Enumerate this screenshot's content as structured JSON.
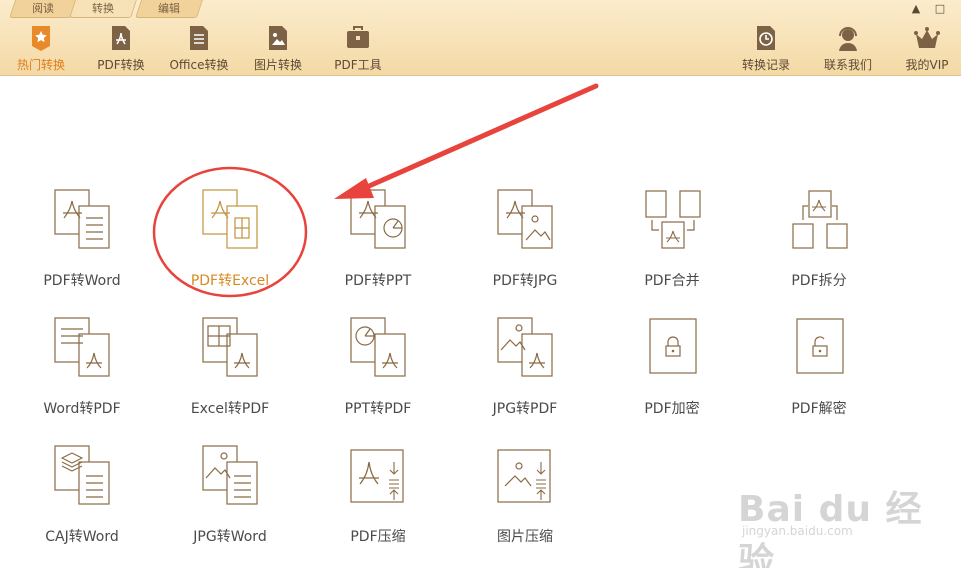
{
  "header": {
    "tabs": [
      {
        "label": "阅读"
      },
      {
        "label": "转换"
      },
      {
        "label": "编辑"
      }
    ],
    "toolbar_left": [
      {
        "label": "热门转换",
        "icon": "star-icon",
        "active": true
      },
      {
        "label": "PDF转换",
        "icon": "pdf-doc-icon"
      },
      {
        "label": "Office转换",
        "icon": "office-doc-icon"
      },
      {
        "label": "图片转换",
        "icon": "image-doc-icon"
      },
      {
        "label": "PDF工具",
        "icon": "toolbox-icon"
      }
    ],
    "toolbar_right": [
      {
        "label": "转换记录",
        "icon": "clock-icon"
      },
      {
        "label": "联系我们",
        "icon": "headset-icon"
      },
      {
        "label": "我的VIP",
        "icon": "crown-icon"
      }
    ],
    "window_controls": [
      "▲",
      "□"
    ]
  },
  "grid": [
    {
      "label": "PDF转Word",
      "icon": "pdf-to-word-icon"
    },
    {
      "label": "PDF转Excel",
      "icon": "pdf-to-excel-icon",
      "selected": true
    },
    {
      "label": "PDF转PPT",
      "icon": "pdf-to-ppt-icon"
    },
    {
      "label": "PDF转JPG",
      "icon": "pdf-to-jpg-icon"
    },
    {
      "label": "PDF合并",
      "icon": "pdf-merge-icon"
    },
    {
      "label": "PDF拆分",
      "icon": "pdf-split-icon"
    },
    {
      "label": "Word转PDF",
      "icon": "word-to-pdf-icon"
    },
    {
      "label": "Excel转PDF",
      "icon": "excel-to-pdf-icon"
    },
    {
      "label": "PPT转PDF",
      "icon": "ppt-to-pdf-icon"
    },
    {
      "label": "JPG转PDF",
      "icon": "jpg-to-pdf-icon"
    },
    {
      "label": "PDF加密",
      "icon": "pdf-encrypt-icon"
    },
    {
      "label": "PDF解密",
      "icon": "pdf-decrypt-icon"
    },
    {
      "label": "CAJ转Word",
      "icon": "caj-to-word-icon"
    },
    {
      "label": "JPG转Word",
      "icon": "jpg-to-word-icon"
    },
    {
      "label": "PDF压缩",
      "icon": "pdf-compress-icon"
    },
    {
      "label": "图片压缩",
      "icon": "image-compress-icon"
    }
  ],
  "watermark": {
    "logo": "Bai du 经验",
    "url": "jingyan.baidu.com"
  },
  "colors": {
    "accent": "#e07d1d",
    "icon_line": "#8a6a45",
    "annotation": "#e8433d",
    "header_bg": "#f6dfb2"
  }
}
